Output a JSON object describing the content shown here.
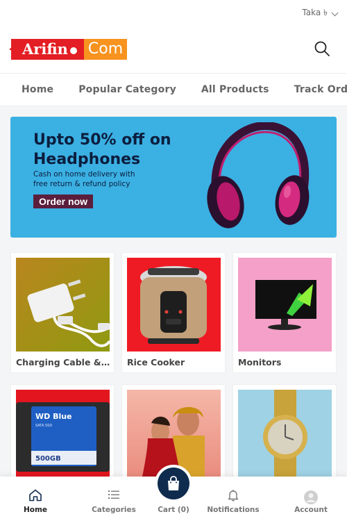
{
  "topbar": {
    "currency": "Taka ৳"
  },
  "header": {
    "logo": {
      "part1": "Arifin",
      "part2": "Com"
    }
  },
  "nav": {
    "items": [
      {
        "label": "Home"
      },
      {
        "label": "Popular Category"
      },
      {
        "label": "All Products"
      },
      {
        "label": "Track Order"
      }
    ]
  },
  "banner": {
    "title_line1": "Upto 50% off on",
    "title_line2": "Headphones",
    "subtitle_line1": "Cash on home delivery with",
    "subtitle_line2": "free return & refund policy",
    "button": "Order now"
  },
  "products": [
    {
      "name": "Charging Cable & Adapter",
      "icon": "charger-image"
    },
    {
      "name": "Rice Cooker",
      "icon": "rice-cooker-image"
    },
    {
      "name": "Monitors",
      "icon": "monitor-image"
    },
    {
      "name": "",
      "icon": "ssd-image"
    },
    {
      "name": "",
      "icon": "wedding-dress-image"
    },
    {
      "name": "",
      "icon": "watch-image"
    }
  ],
  "bottom_nav": {
    "home": "Home",
    "categories": "Categories",
    "cart": "Cart (0)",
    "notifications": "Notifications",
    "account": "Account"
  },
  "colors": {
    "brand_red": "#e31e24",
    "brand_orange": "#f7931e",
    "banner_bg": "#3bb0e3",
    "cart_button": "#0f2c4e"
  }
}
